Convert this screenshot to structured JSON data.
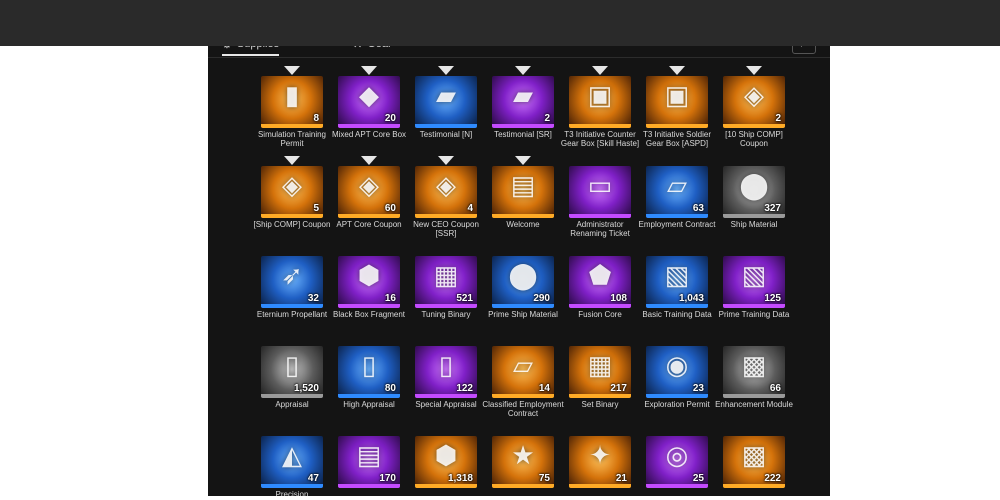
{
  "tabs": [
    {
      "label": "Supplies",
      "icon": "gear-cluster-icon",
      "active": true
    },
    {
      "label": "Gear",
      "icon": "wrench-icon",
      "active": false
    }
  ],
  "search": {
    "icon": "search-icon",
    "glyph": "⌕"
  },
  "colors": {
    "gold": "#ffab26",
    "purple": "#c44bff",
    "blue": "#2f8bff",
    "gray": "#9a9a9a"
  },
  "items": [
    {
      "name": "Simulation Training Permit",
      "qty": "8",
      "rarity": "gold",
      "icon": "training-permit-icon",
      "glyph": "▮"
    },
    {
      "name": "Mixed APT Core Box",
      "qty": "20",
      "rarity": "purple",
      "icon": "core-box-icon",
      "glyph": "◆"
    },
    {
      "name": "Testimonial [N]",
      "qty": "",
      "rarity": "blue",
      "icon": "testimonial-case-icon",
      "glyph": "▰"
    },
    {
      "name": "Testimonial [SR]",
      "qty": "2",
      "rarity": "purple",
      "icon": "testimonial-case-icon",
      "glyph": "▰"
    },
    {
      "name": "T3 Initiative Counter Gear Box [Skill Haste]",
      "qty": "",
      "rarity": "gold",
      "icon": "gear-box-icon",
      "glyph": "▣"
    },
    {
      "name": "T3 Initiative Soldier Gear Box [ASPD]",
      "qty": "",
      "rarity": "gold",
      "icon": "gear-box-icon",
      "glyph": "▣"
    },
    {
      "name": "[10 Ship COMP] Coupon",
      "qty": "2",
      "rarity": "gold",
      "icon": "ship-coupon-icon",
      "glyph": "◈"
    },
    {
      "name": "[Ship COMP] Coupon",
      "qty": "5",
      "rarity": "gold",
      "icon": "ship-coupon-icon",
      "glyph": "◈"
    },
    {
      "name": "APT Core Coupon",
      "qty": "60",
      "rarity": "gold",
      "icon": "core-coupon-icon",
      "glyph": "◈"
    },
    {
      "name": "New CEO Coupon [SSR]",
      "qty": "4",
      "rarity": "gold",
      "icon": "ceo-coupon-icon",
      "glyph": "◈"
    },
    {
      "name": "Welcome",
      "qty": "",
      "rarity": "gold",
      "icon": "welcome-card-icon",
      "glyph": "▤"
    },
    {
      "name": "Administrator Renaming Ticket",
      "qty": "",
      "rarity": "purple",
      "icon": "rename-ticket-icon",
      "glyph": "▭"
    },
    {
      "name": "Employment Contract",
      "qty": "63",
      "rarity": "blue",
      "icon": "contract-icon",
      "glyph": "▱"
    },
    {
      "name": "Ship Material",
      "qty": "327",
      "rarity": "gray",
      "icon": "ship-material-icon",
      "glyph": "⬤"
    },
    {
      "name": "Eternium Propellant",
      "qty": "32",
      "rarity": "blue",
      "icon": "propellant-icon",
      "glyph": "➶"
    },
    {
      "name": "Black Box Fragment",
      "qty": "16",
      "rarity": "purple",
      "icon": "black-box-icon",
      "glyph": "⬢"
    },
    {
      "name": "Tuning Binary",
      "qty": "521",
      "rarity": "purple",
      "icon": "binary-icon",
      "glyph": "▦"
    },
    {
      "name": "Prime Ship Material",
      "qty": "290",
      "rarity": "blue",
      "icon": "ship-material-icon",
      "glyph": "⬤"
    },
    {
      "name": "Fusion Core",
      "qty": "108",
      "rarity": "purple",
      "icon": "fusion-core-icon",
      "glyph": "⬟"
    },
    {
      "name": "Basic Training Data",
      "qty": "1,043",
      "rarity": "blue",
      "icon": "training-data-icon",
      "glyph": "▧"
    },
    {
      "name": "Prime Training Data",
      "qty": "125",
      "rarity": "purple",
      "icon": "training-data-icon",
      "glyph": "▧"
    },
    {
      "name": "Appraisal",
      "qty": "1,520",
      "rarity": "gray",
      "icon": "clipboard-icon",
      "glyph": "▯"
    },
    {
      "name": "High Appraisal",
      "qty": "80",
      "rarity": "blue",
      "icon": "clipboard-icon",
      "glyph": "▯"
    },
    {
      "name": "Special Appraisal",
      "qty": "122",
      "rarity": "purple",
      "icon": "clipboard-icon",
      "glyph": "▯"
    },
    {
      "name": "Classified Employment Contract",
      "qty": "14",
      "rarity": "gold",
      "icon": "contract-icon",
      "glyph": "▱"
    },
    {
      "name": "Set Binary",
      "qty": "217",
      "rarity": "gold",
      "icon": "binary-icon",
      "glyph": "▦"
    },
    {
      "name": "Exploration Permit",
      "qty": "23",
      "rarity": "blue",
      "icon": "exploration-permit-icon",
      "glyph": "◉"
    },
    {
      "name": "Enhancement Module",
      "qty": "66",
      "rarity": "gray",
      "icon": "module-icon",
      "glyph": "▩"
    },
    {
      "name": "Precision",
      "qty": "47",
      "rarity": "blue",
      "icon": "precision-icon",
      "glyph": "◭"
    },
    {
      "name": "",
      "qty": "170",
      "rarity": "purple",
      "icon": "blueprint-icon",
      "glyph": "▤"
    },
    {
      "name": "",
      "qty": "1,318",
      "rarity": "gold",
      "icon": "hexagon-badge-icon",
      "glyph": "⬢"
    },
    {
      "name": "",
      "qty": "75",
      "rarity": "gold",
      "icon": "star-badge-icon",
      "glyph": "★"
    },
    {
      "name": "",
      "qty": "21",
      "rarity": "gold",
      "icon": "crystal-icon",
      "glyph": "✦"
    },
    {
      "name": "",
      "qty": "25",
      "rarity": "purple",
      "icon": "disc-icon",
      "glyph": "◎"
    },
    {
      "name": "",
      "qty": "222",
      "rarity": "gold",
      "icon": "module-icon",
      "glyph": "▩"
    }
  ],
  "new_markers": [
    0,
    1,
    2,
    3,
    4,
    5,
    6,
    7,
    8,
    9,
    10
  ]
}
